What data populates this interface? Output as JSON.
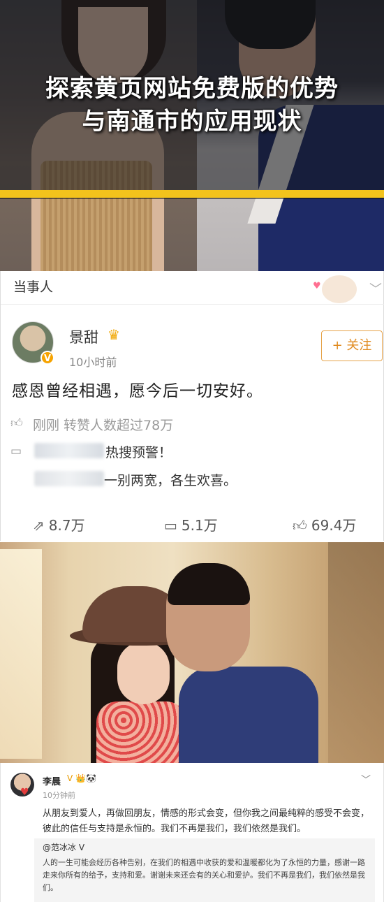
{
  "hero": {
    "title_line1": "探索黄页网站免费版的优势",
    "title_line2": "与南通市的应用现状"
  },
  "weibo_post": {
    "section_label": "当事人",
    "author": "景甜",
    "verified_badge": "V",
    "time": "10小时前",
    "follow_button": "+ 关注",
    "text": "感恩曾经相遇，愿今后一切安好。",
    "repost_status": "刚刚 转赞人数超过78万",
    "hot_search_alert": "热搜预警！",
    "comment_preview": "一别两宽，各生欢喜。",
    "actions": {
      "repost": "8.7万",
      "comment": "5.1万",
      "like": "69.4万"
    }
  },
  "second_post": {
    "author": "李晨",
    "badges": "V 👑🐼",
    "time": "10分钟前",
    "text": "从朋友到爱人，再做回朋友，情感的形式会变，但你我之间最纯粹的感受不会变，彼此的信任与支持是永恒的。我们不再是我们，我们依然是我们。",
    "quoted_author": "@范冰冰 V",
    "quoted_text": "人的一生可能会经历各种告别，在我们的相遇中收获的爱和温暖都化为了永恒的力量，感谢一路走来你所有的给予，支持和爱。谢谢未来还会有的关心和爱护。我们不再是我们，我们依然是我们。"
  },
  "colors": {
    "stripe": "#f3c31c",
    "follow_accent": "#e08a1e",
    "verified": "#f6a300"
  },
  "icons": [
    "crown-icon",
    "like-icon",
    "comment-icon",
    "repost-icon",
    "chevron-down-icon",
    "heart-icon"
  ]
}
